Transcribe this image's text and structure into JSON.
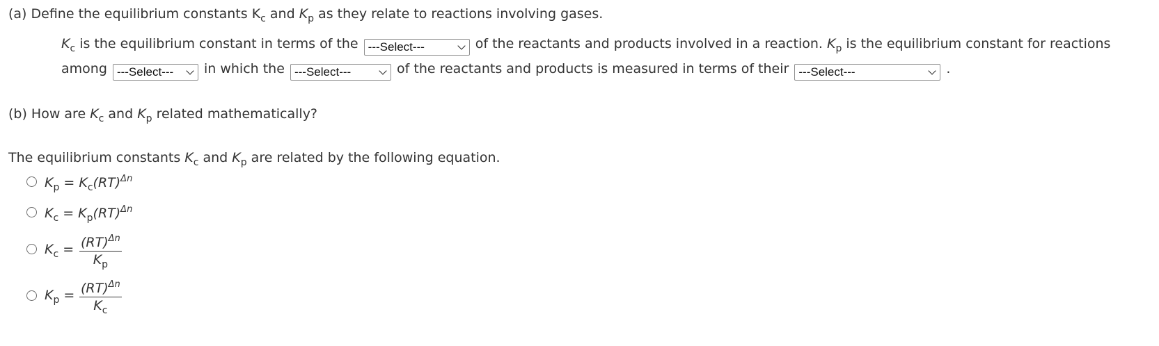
{
  "part_a": {
    "question": "(a) Define the equilibrium constants K",
    "q_sub_c": "c",
    "q_and": " and ",
    "q_K2": "K",
    "q_sub_p": "p",
    "q_rest": " as they relate to reactions involving gases.",
    "l1_k": "K",
    "l1_c": "c",
    "l1_t1": " is the equilibrium constant in terms of the",
    "l1_t2": "of the reactants and products involved in a reaction. ",
    "l1_k2": "K",
    "l1_p": "p",
    "l1_t3": " is the equilibrium constant for reactions",
    "l2_t1": "among",
    "l2_t2": "in which the",
    "l2_t3": "of the reactants and products is measured in terms of their",
    "l2_end": ".",
    "select_1": "---Select---",
    "select_2": "---Select---",
    "select_3": "---Select---",
    "select_4": "---Select---"
  },
  "part_b": {
    "question_pre": "(b) How are ",
    "q_k1": "K",
    "q_c": "c",
    "q_and": " and ",
    "q_k2": "K",
    "q_p": "p",
    "q_rest": " related mathematically?",
    "statement_pre": "The equilibrium constants ",
    "s_k1": "K",
    "s_c": "c",
    "s_and": " and ",
    "s_k2": "K",
    "s_p": "p",
    "s_rest": " are related by the following equation.",
    "options": [
      {
        "lhs": "K",
        "lhs_sub": "p",
        "eq": " = ",
        "rhs": "K",
        "rhs_sub": "c",
        "rhs_rest": "(RT)",
        "exp": "Δn"
      },
      {
        "lhs": "K",
        "lhs_sub": "c",
        "eq": " = ",
        "rhs": "K",
        "rhs_sub": "p",
        "rhs_rest": "(RT)",
        "exp": "Δn"
      },
      {
        "lhs": "K",
        "lhs_sub": "c",
        "eq": " = ",
        "num": "(RT)",
        "num_exp": "Δn",
        "den": "K",
        "den_sub": "p"
      },
      {
        "lhs": "K",
        "lhs_sub": "p",
        "eq": " = ",
        "num": "(RT)",
        "num_exp": "Δn",
        "den": "K",
        "den_sub": "c"
      }
    ]
  },
  "colors": {
    "text": "#333333",
    "border": "#8f8f8f"
  }
}
